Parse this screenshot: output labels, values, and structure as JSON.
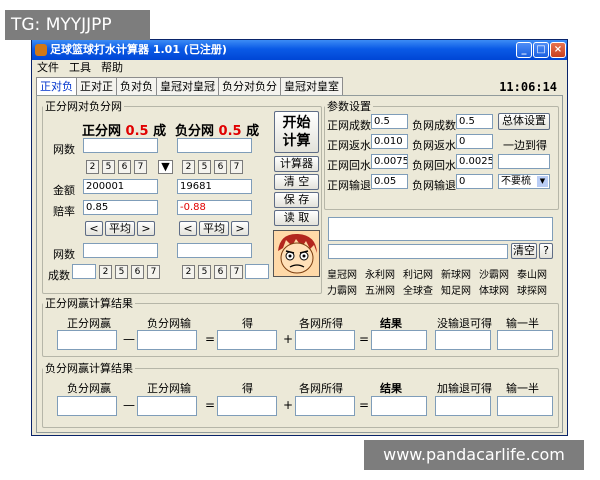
{
  "watermarks": {
    "top": "TG: MYYJJPP",
    "bottom": "www.pandacarlife.com"
  },
  "window": {
    "title": "足球篮球打水计算器 1.01 (已注册)",
    "minimize": "_",
    "maximize": "□",
    "close": "×"
  },
  "menu": [
    "文件",
    "工具",
    "帮助"
  ],
  "tabs": [
    "正对负",
    "正对正",
    "负对负",
    "皇冠对皇冠",
    "负分对负分",
    "皇冠对皇室"
  ],
  "clock": "11:06:14",
  "main_group": {
    "legend": "正分网对负分网",
    "left_header": {
      "a": "正分网",
      "b": "0.5",
      "c": "成"
    },
    "right_header": {
      "a": "负分网",
      "b": "0.5",
      "c": "成"
    },
    "labels": {
      "wangshu": "网数",
      "jine": "金额",
      "peilv": "赔率",
      "wangshu2": "网数",
      "chengshu": "成数"
    },
    "spin": [
      "2",
      "5",
      "6",
      "7"
    ],
    "arrow": "▼",
    "left_amount": "200001",
    "right_amount": "19681",
    "left_odds": "0.85",
    "right_odds": "-0.88",
    "lt": "<",
    "avg": "平均",
    "gt": ">",
    "start": "开始\n计算",
    "calculator": "计算器",
    "clear": "清 空",
    "save": "保 存",
    "read": "读 取"
  },
  "params": {
    "legend": "参数设置",
    "rows": [
      {
        "l1": "正网成数",
        "v1": "0.5",
        "l2": "负网成数",
        "v2": "0.5"
      },
      {
        "l1": "正网返水",
        "v1": "0.010",
        "l2": "负网返水",
        "v2": "0"
      },
      {
        "l1": "正网回水",
        "v1": "0.0075",
        "l2": "负网回水",
        "v2": "0.0025"
      },
      {
        "l1": "正网输退",
        "v1": "0.05",
        "l2": "负网输退",
        "v2": "0"
      }
    ],
    "overall": "总体设置",
    "bothwin": "一边到得",
    "dropdown": "不要梳",
    "clear_small": "清空",
    "question": "?"
  },
  "links": [
    "皇冠网",
    "永利网",
    "利记网",
    "新球网",
    "沙霸网",
    "泰山网",
    "力霸网",
    "五洲网",
    "全球查",
    "知足网",
    "体球网",
    "球探网"
  ],
  "result1": {
    "legend": "正分网赢计算结果",
    "h1": "正分网赢",
    "h2": "负分网输",
    "h3": "得",
    "h4": "各网所得",
    "h5": "结果",
    "h6": "没输退可得",
    "h7": "输一半"
  },
  "result2": {
    "legend": "负分网赢计算结果",
    "h1": "负分网赢",
    "h2": "正分网输",
    "h3": "得",
    "h4": "各网所得",
    "h5": "结果",
    "h6": "加输退可得",
    "h7": "输一半"
  },
  "ops": {
    "minus": "—",
    "eq": "=",
    "plus": "+"
  }
}
